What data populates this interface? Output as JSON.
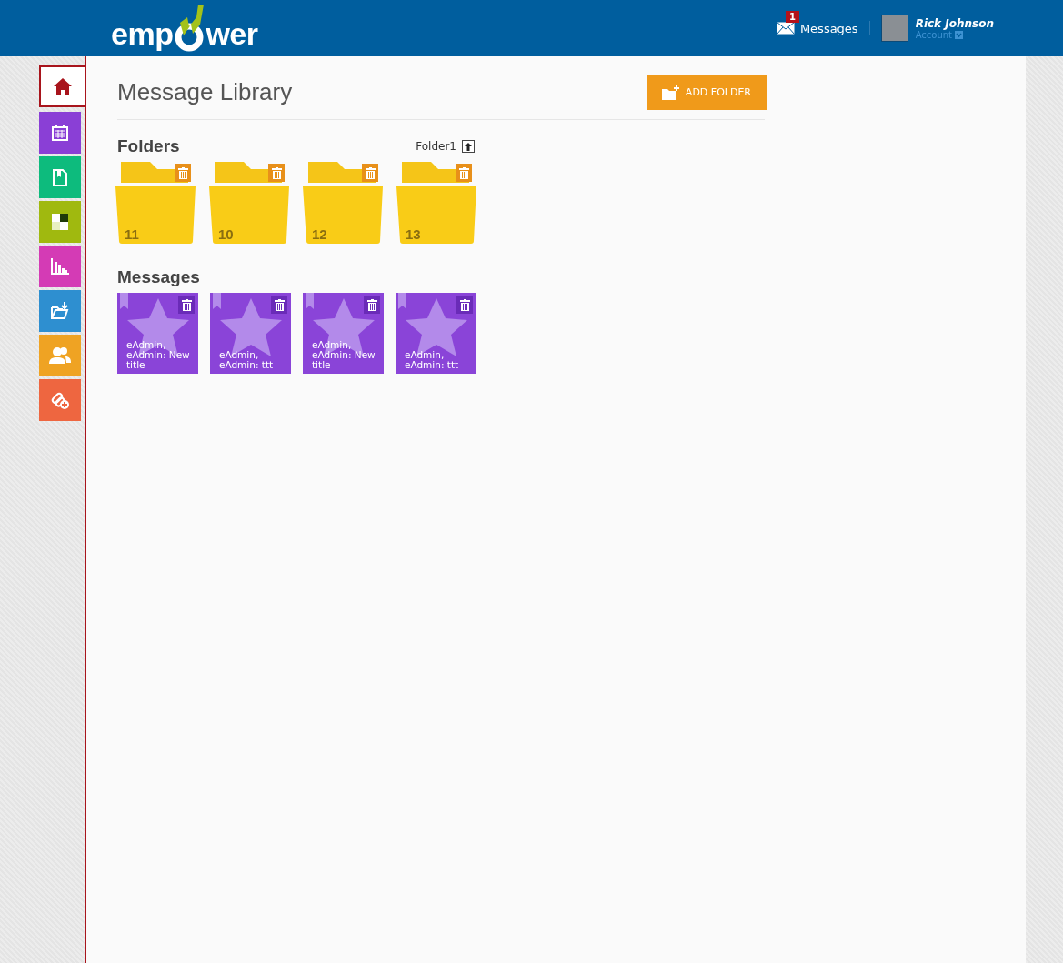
{
  "header": {
    "logo": {
      "before": "emp",
      "after": "wer"
    },
    "messages": {
      "label": "Messages",
      "badge": "1"
    },
    "user": {
      "name": "Rick Johnson",
      "account": "Account"
    }
  },
  "sidebar": {
    "items": [
      {
        "kind": "home",
        "color": "#ffffff",
        "selected": true
      },
      {
        "kind": "calendar",
        "color": "#8a3fd6",
        "selected": false
      },
      {
        "kind": "document",
        "color": "#0dbb7d",
        "selected": false
      },
      {
        "kind": "checker",
        "color": "#a0b90f",
        "selected": false
      },
      {
        "kind": "chart",
        "color": "#d43bb5",
        "selected": false
      },
      {
        "kind": "import",
        "color": "#2e8fd0",
        "selected": false
      },
      {
        "kind": "users",
        "color": "#efa323",
        "selected": false
      },
      {
        "kind": "link",
        "color": "#ee6640",
        "selected": false
      }
    ]
  },
  "page": {
    "title": "Message Library",
    "add_button": "ADD FOLDER"
  },
  "folders": {
    "heading": "Folders",
    "current": "Folder1",
    "items": [
      "11",
      "10",
      "12",
      "13"
    ]
  },
  "messages": {
    "heading": "Messages",
    "items": [
      "eAdmin, eAdmin: New title",
      "eAdmin, eAdmin: ttt",
      "eAdmin, eAdmin: New title",
      "eAdmin, eAdmin: ttt"
    ]
  }
}
